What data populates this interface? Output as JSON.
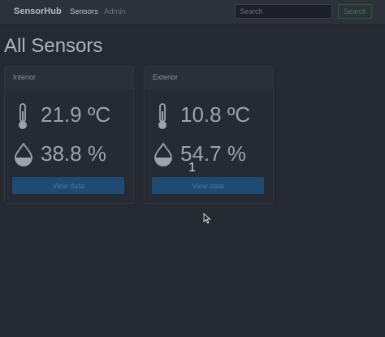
{
  "navbar": {
    "brand": "SensorHub",
    "links": [
      "Sensors",
      "Admin"
    ],
    "search": {
      "placeholder": "Search",
      "value": ""
    },
    "search_button": "Search"
  },
  "page": {
    "title": "All Sensors"
  },
  "cards": [
    {
      "title": "Interior",
      "temperature": "21.9 ºC",
      "humidity": "38.8 %",
      "button": "View data",
      "icons": [
        "thermometer-icon",
        "droplet-icon"
      ]
    },
    {
      "title": "Exterior",
      "temperature": "10.8 ºC",
      "humidity": "54.7 %",
      "button": "View data",
      "icons": [
        "thermometer-icon",
        "droplet-icon"
      ]
    }
  ],
  "overlay_number": "1",
  "colors": {
    "background": "#252a32",
    "navbar": "#2c323a",
    "card_header": "#2b3037",
    "primary_button": "#1f4b72",
    "search_button_border": "#2e5a3c"
  }
}
